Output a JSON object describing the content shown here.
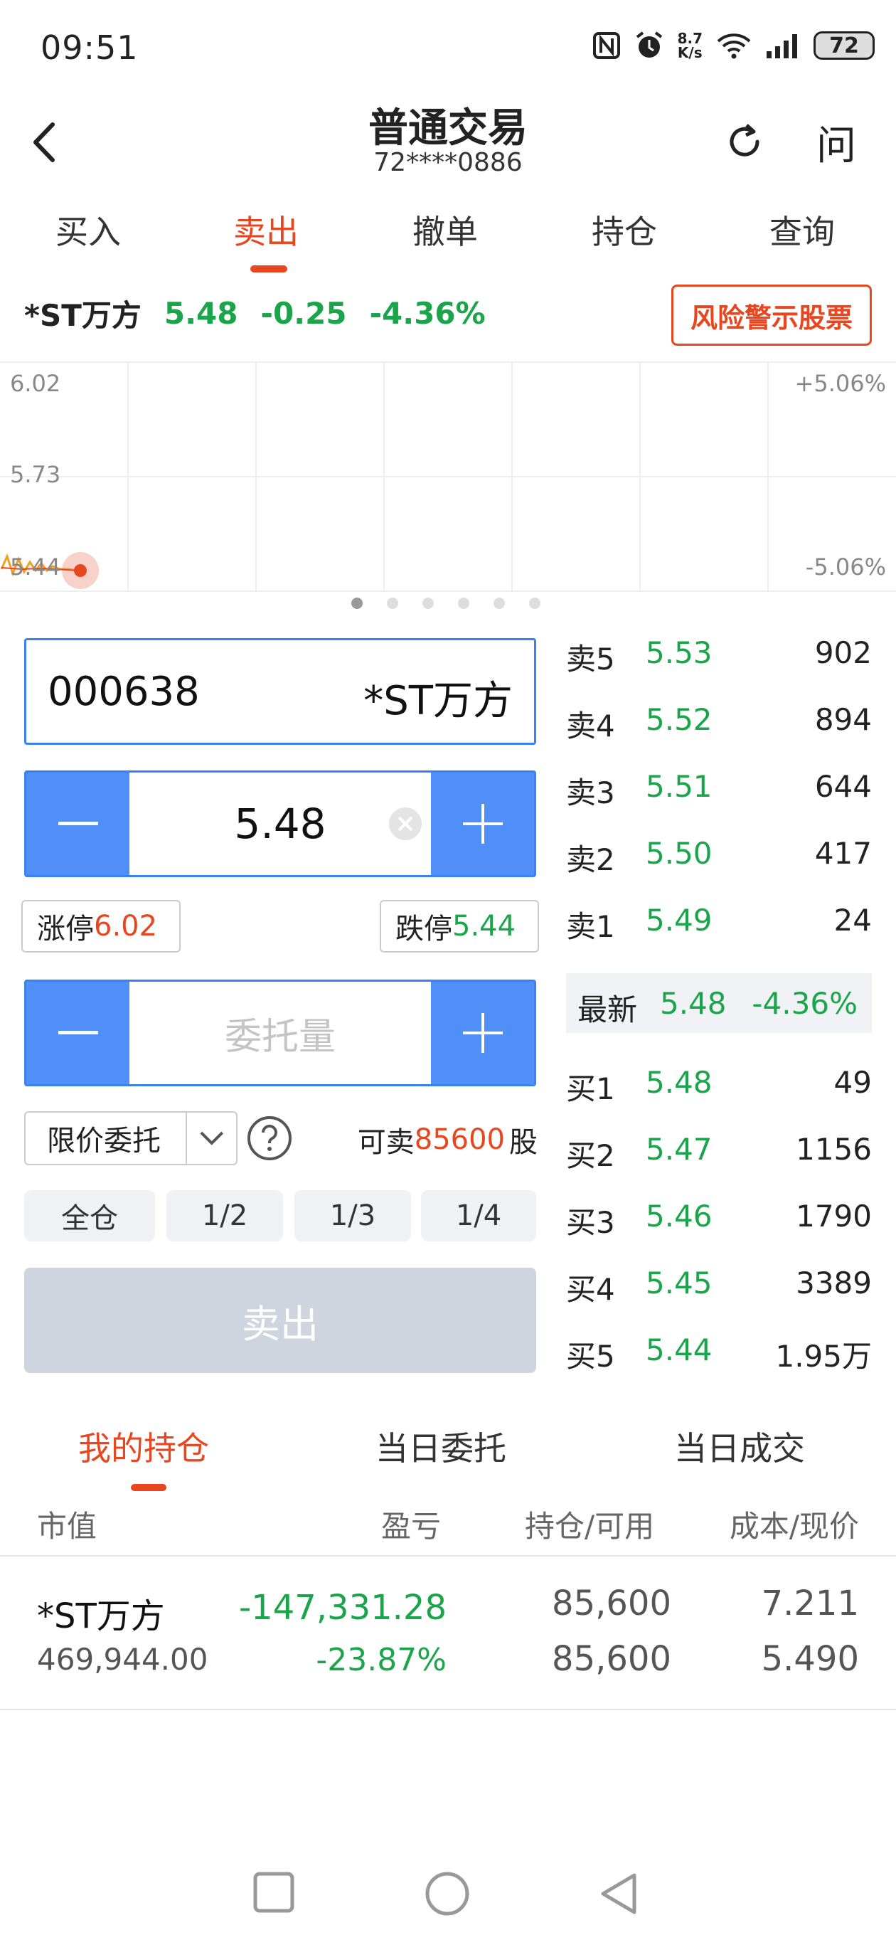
{
  "status_bar": {
    "time": "09:51",
    "net_speed_top": "8.7",
    "net_speed_bottom": "K/s",
    "battery": "72"
  },
  "header": {
    "title": "普通交易",
    "account": "72****0886",
    "help_label": "问"
  },
  "tabs": [
    {
      "label": "买入"
    },
    {
      "label": "卖出"
    },
    {
      "label": "撤单"
    },
    {
      "label": "持仓"
    },
    {
      "label": "查询"
    }
  ],
  "active_tab": "卖出",
  "stock": {
    "name": "*ST万方",
    "price": "5.48",
    "change": "-0.25",
    "change_pct": "-4.36%",
    "risk_label": "风险警示股票"
  },
  "chart": {
    "y_top": "6.02",
    "y_mid": "5.73",
    "y_bottom": "5.44",
    "pct_top": "+5.06%",
    "pct_bottom": "-5.06%",
    "pages": 6,
    "active_page": 0
  },
  "order_form": {
    "code": "000638",
    "code_name": "*ST万方",
    "price": "5.48",
    "limit_up_label": "涨停",
    "limit_up": "6.02",
    "limit_down_label": "跌停",
    "limit_down": "5.44",
    "qty_placeholder": "委托量",
    "order_type": "限价委托",
    "sellable_prefix": "可卖",
    "sellable": "85600",
    "sellable_unit": "股",
    "fractions": [
      "全仓",
      "1/2",
      "1/3",
      "1/4"
    ],
    "sell_label": "卖出"
  },
  "order_book": {
    "asks": [
      {
        "level": "卖5",
        "price": "5.53",
        "qty": "902"
      },
      {
        "level": "卖4",
        "price": "5.52",
        "qty": "894"
      },
      {
        "level": "卖3",
        "price": "5.51",
        "qty": "644"
      },
      {
        "level": "卖2",
        "price": "5.50",
        "qty": "417"
      },
      {
        "level": "卖1",
        "price": "5.49",
        "qty": "24"
      }
    ],
    "latest": {
      "label": "最新",
      "price": "5.48",
      "pct": "-4.36%"
    },
    "bids": [
      {
        "level": "买1",
        "price": "5.48",
        "qty": "49"
      },
      {
        "level": "买2",
        "price": "5.47",
        "qty": "1156"
      },
      {
        "level": "买3",
        "price": "5.46",
        "qty": "1790"
      },
      {
        "level": "买4",
        "price": "5.45",
        "qty": "3389"
      },
      {
        "level": "买5",
        "price": "5.44",
        "qty": "1.95万"
      }
    ]
  },
  "bottom_tabs": [
    {
      "label": "我的持仓"
    },
    {
      "label": "当日委托"
    },
    {
      "label": "当日成交"
    }
  ],
  "positions_header": {
    "market_value": "市值",
    "pnl": "盈亏",
    "holding": "持仓/可用",
    "cost": "成本/现价"
  },
  "positions": [
    {
      "name": "*ST万方",
      "market_value": "469,944.00",
      "pnl": "-147,331.28",
      "pnl_pct": "-23.87%",
      "holding": "85,600",
      "available": "85,600",
      "cost": "7.211",
      "current": "5.490"
    }
  ],
  "colors": {
    "accent": "#e8461f",
    "down": "#1aa54a",
    "blue": "#4f8ff7"
  }
}
